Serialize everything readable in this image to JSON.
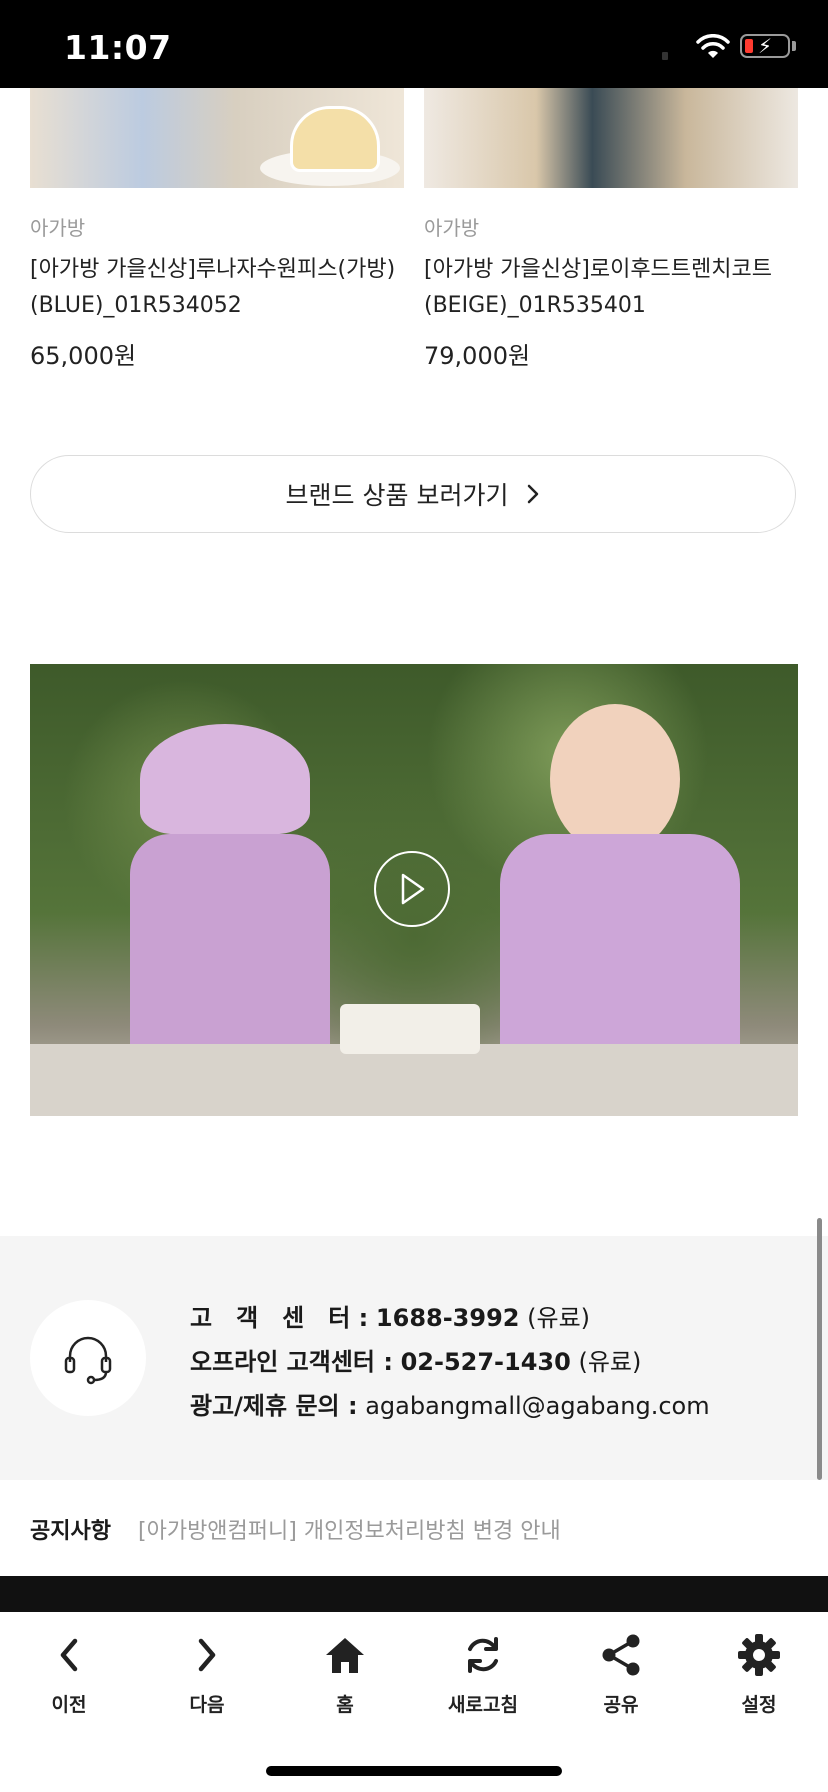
{
  "status_bar": {
    "time": "11:07"
  },
  "products": [
    {
      "brand": "아가방",
      "name": "[아가방 가을신상]루나자수원피스(가방)(BLUE)_01R534052",
      "price": "65,000원"
    },
    {
      "brand": "아가방",
      "name": "[아가방 가을신상]로이후드트렌치코트(BEIGE)_01R535401",
      "price": "79,000원"
    }
  ],
  "brand_button": {
    "label": "브랜드 상품 보러가기"
  },
  "customer_center": {
    "line1_label": "고　객　센　터 :",
    "line1_number": "1688-3992",
    "line1_suffix": "(유료)",
    "line2_label": "오프라인 고객센터 :",
    "line2_number": "02-527-1430",
    "line2_suffix": "(유료)",
    "line3_label": "광고/제휴 문의 :",
    "line3_value": "agabangmall@agabang.com"
  },
  "notice": {
    "label": "공지사항",
    "text": "[아가방앤컴퍼니] 개인정보처리방침 변경 안내"
  },
  "toolbar": {
    "back": "이전",
    "forward": "다음",
    "home": "홈",
    "refresh": "새로고침",
    "share": "공유",
    "settings": "설정"
  },
  "colors": {
    "accent": "#1a1a1a",
    "muted": "#9a9a9a",
    "panel": "#f5f5f5"
  }
}
